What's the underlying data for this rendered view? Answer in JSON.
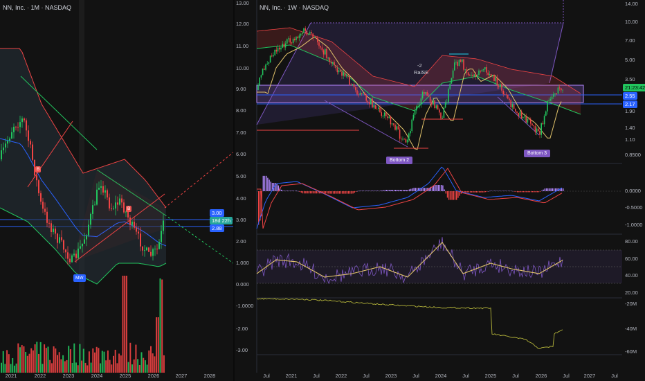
{
  "left_chart": {
    "title": "NN, Inc. · 1M · NASDAQ",
    "x_ticks": [
      "2021",
      "2022",
      "2023",
      "2024",
      "2025",
      "2026",
      "2027",
      "2028"
    ],
    "price_badges": [
      "3.00",
      "18d 22h",
      "2.88"
    ],
    "mw_label": "MW",
    "marker_labels": [
      "B",
      "B"
    ],
    "colors": {
      "up": "#22c55e",
      "down": "#ef4444",
      "blue_line": "#2962ff",
      "band": "#ef4444"
    }
  },
  "right_chart": {
    "title": "NN, Inc. · 1W · NASDAQ",
    "left_axis_main": [
      "13.00",
      "12.00",
      "11.00",
      "10.00",
      "9.00",
      "8.00",
      "7.00",
      "6.00"
    ],
    "left_axis_macd": [
      "5.00",
      "4.00",
      "3.00"
    ],
    "left_axis_rsi": [
      "2.00",
      "1.000",
      "0.000"
    ],
    "left_axis_obv": [
      "-1.0000",
      "-2.00",
      "-3.00"
    ],
    "right_axis_main": [
      "14.00",
      "10.00",
      "7.00",
      "5.00",
      "3.50",
      "2.55",
      "2.17",
      "1.90",
      "1.40",
      "1.10",
      "0.8500"
    ],
    "right_axis_macd": [
      "0.0000",
      "-0.5000",
      "-1.0000"
    ],
    "right_axis_rsi": [
      "80.00",
      "60.00",
      "40.00",
      "20.00"
    ],
    "right_axis_obv": [
      "-20M",
      "-40M",
      "-60M"
    ],
    "price_badges": {
      "timer": "21:23:42",
      "level1": "2.55",
      "level2": "2.17"
    },
    "annotations": {
      "bottom2": "Bottom 2",
      "bottom3": "Bottom 3",
      "raise_top": "-2",
      "raise_bottom": "RaiSE"
    },
    "x_ticks": [
      "Jul",
      "2021",
      "Jul",
      "2022",
      "Jul",
      "2023",
      "Jul",
      "2024",
      "Jul",
      "2025",
      "Jul",
      "2026",
      "Jul",
      "2027",
      "Jul"
    ]
  }
}
